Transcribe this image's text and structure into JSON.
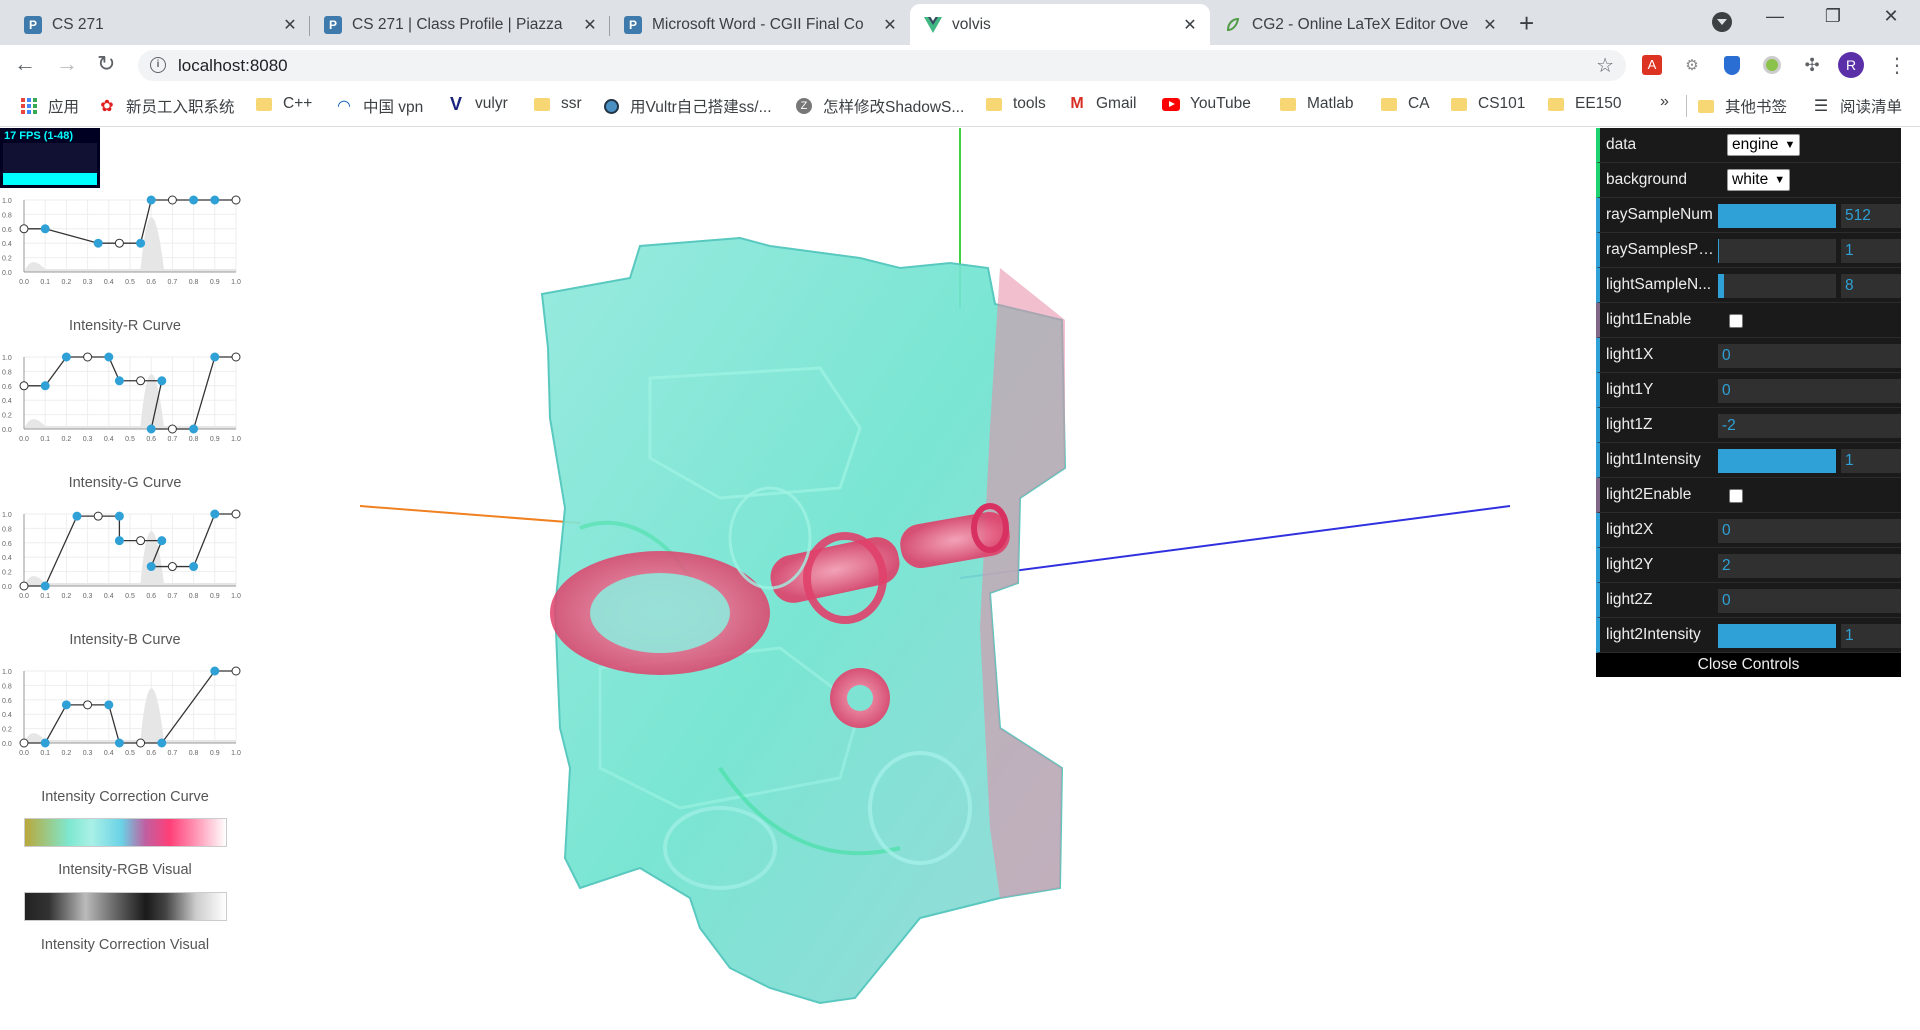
{
  "tabs": [
    {
      "title": "CS 271",
      "icon": "piazza-icon"
    },
    {
      "title": "CS 271 | Class Profile | Piazza",
      "icon": "piazza-icon"
    },
    {
      "title": "Microsoft Word - CGII Final Co",
      "icon": "piazza-icon"
    },
    {
      "title": "volvis",
      "icon": "vue-icon"
    },
    {
      "title": "CG2 - Online LaTeX Editor Ove",
      "icon": "overleaf-icon"
    }
  ],
  "address": {
    "url": "localhost:8080"
  },
  "profile": {
    "initial": "R"
  },
  "bookmarks": [
    {
      "label": "应用",
      "icon": "apps-icon"
    },
    {
      "label": "新员工入职系统",
      "icon": "huawei-icon"
    },
    {
      "label": "C++",
      "icon": "folder-icon"
    },
    {
      "label": "中国 vpn",
      "icon": "vpn-icon"
    },
    {
      "label": "vulyr",
      "icon": "vultr-icon"
    },
    {
      "label": "ssr",
      "icon": "folder-icon"
    },
    {
      "label": "用Vultr自己搭建ss/...",
      "icon": "globe-icon"
    },
    {
      "label": "怎样修改ShadowS...",
      "icon": "zhihu-icon"
    },
    {
      "label": "tools",
      "icon": "folder-icon"
    },
    {
      "label": "Gmail",
      "icon": "gmail-icon"
    },
    {
      "label": "YouTube",
      "icon": "youtube-icon"
    },
    {
      "label": "Matlab",
      "icon": "folder-icon"
    },
    {
      "label": "CA",
      "icon": "folder-icon"
    },
    {
      "label": "CS101",
      "icon": "folder-icon"
    },
    {
      "label": "EE150",
      "icon": "folder-icon"
    }
  ],
  "bookmarks_more": "»",
  "other_bookmarks": "其他书签",
  "reading_list": "阅读清单",
  "fps": {
    "text": "17 FPS (1-48)"
  },
  "curves": [
    {
      "label": "Intensity-R Curve",
      "points": [
        [
          0,
          0.6
        ],
        [
          0.1,
          0.6
        ],
        [
          0.35,
          0.4
        ],
        [
          0.45,
          0.4
        ],
        [
          0.55,
          0.4
        ],
        [
          0.6,
          1.0
        ],
        [
          0.7,
          1.0
        ],
        [
          0.8,
          1.0
        ],
        [
          0.9,
          1.0
        ],
        [
          1.0,
          1.0
        ]
      ]
    },
    {
      "label": "Intensity-G Curve",
      "points": [
        [
          0,
          0.6
        ],
        [
          0.1,
          0.6
        ],
        [
          0.2,
          1.0
        ],
        [
          0.3,
          1.0
        ],
        [
          0.4,
          1.0
        ],
        [
          0.45,
          0.67
        ],
        [
          0.55,
          0.67
        ],
        [
          0.65,
          0.67
        ],
        [
          0.6,
          0.0
        ],
        [
          0.7,
          0.0
        ],
        [
          0.8,
          0.0
        ],
        [
          0.9,
          1.0
        ],
        [
          1.0,
          1.0
        ]
      ]
    },
    {
      "label": "Intensity-B Curve",
      "points": [
        [
          0,
          0.0
        ],
        [
          0.1,
          0.0
        ],
        [
          0.25,
          0.97
        ],
        [
          0.35,
          0.97
        ],
        [
          0.45,
          0.97
        ],
        [
          0.45,
          0.63
        ],
        [
          0.55,
          0.63
        ],
        [
          0.65,
          0.63
        ],
        [
          0.6,
          0.27
        ],
        [
          0.7,
          0.27
        ],
        [
          0.8,
          0.27
        ],
        [
          0.9,
          1.0
        ],
        [
          1.0,
          1.0
        ]
      ]
    },
    {
      "label": "Intensity Correction Curve",
      "points": [
        [
          0,
          0.0
        ],
        [
          0.1,
          0.0
        ],
        [
          0.2,
          0.53
        ],
        [
          0.3,
          0.53
        ],
        [
          0.4,
          0.53
        ],
        [
          0.45,
          0.0
        ],
        [
          0.55,
          0.0
        ],
        [
          0.65,
          0.0
        ],
        [
          0.9,
          1.0
        ],
        [
          1.0,
          1.0
        ]
      ]
    }
  ],
  "ticks": [
    "0.0",
    "0.1",
    "0.2",
    "0.3",
    "0.4",
    "0.5",
    "0.6",
    "0.7",
    "0.8",
    "0.9",
    "1.0"
  ],
  "yticks": [
    "1.0",
    "0.8",
    "0.6",
    "0.4",
    "0.2",
    "0.0"
  ],
  "visuals": {
    "rgb_label": "Intensity-RGB Visual",
    "corr_label": "Intensity Correction Visual"
  },
  "gui": {
    "data": {
      "label": "data",
      "value": "engine"
    },
    "background": {
      "label": "background",
      "value": "white"
    },
    "raySampleNum": {
      "label": "raySampleNum",
      "value": "512",
      "fill": 1.0
    },
    "raySamplesPerPixel": {
      "label": "raySamplesPe...",
      "value": "1",
      "fill": 0.0
    },
    "lightSampleNum": {
      "label": "lightSampleN...",
      "value": "8",
      "fill": 0.05
    },
    "light1Enable": {
      "label": "light1Enable",
      "checked": false
    },
    "light1X": {
      "label": "light1X",
      "value": "0"
    },
    "light1Y": {
      "label": "light1Y",
      "value": "0"
    },
    "light1Z": {
      "label": "light1Z",
      "value": "-2"
    },
    "light1Intensity": {
      "label": "light1Intensity",
      "value": "1",
      "fill": 1.0
    },
    "light2Enable": {
      "label": "light2Enable",
      "checked": false
    },
    "light2X": {
      "label": "light2X",
      "value": "0"
    },
    "light2Y": {
      "label": "light2Y",
      "value": "2"
    },
    "light2Z": {
      "label": "light2Z",
      "value": "0"
    },
    "light2Intensity": {
      "label": "light2Intensity",
      "value": "1",
      "fill": 1.0
    },
    "close": "Close Controls"
  }
}
